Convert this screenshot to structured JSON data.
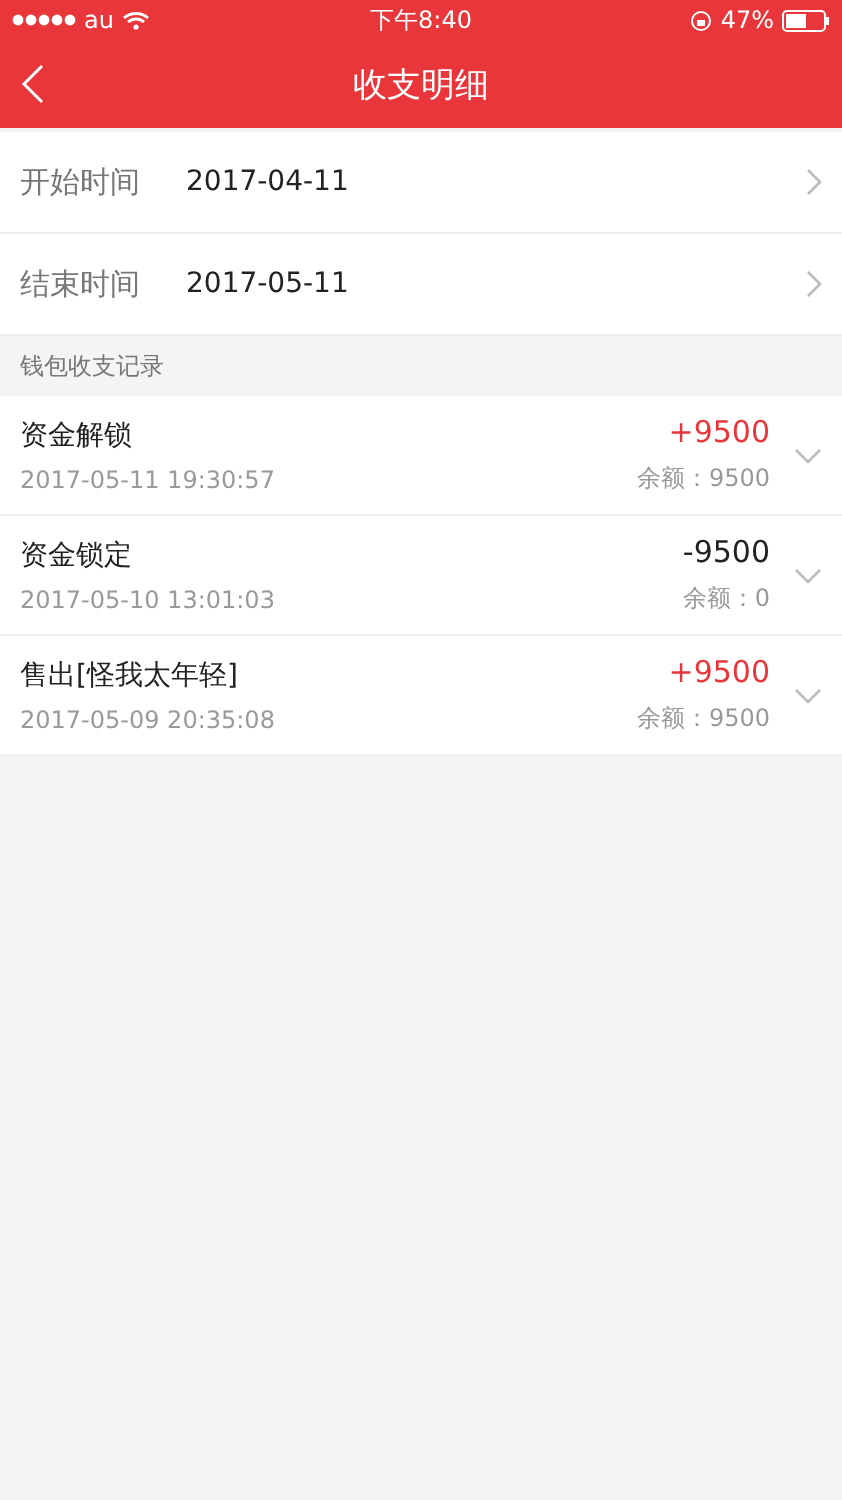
{
  "status_bar": {
    "carrier": "au",
    "time": "下午8:40",
    "battery": "47%"
  },
  "nav": {
    "title": "收支明细"
  },
  "filters": [
    {
      "label": "开始时间",
      "value": "2017-04-11"
    },
    {
      "label": "结束时间",
      "value": "2017-05-11"
    }
  ],
  "section": {
    "title": "钱包收支记录"
  },
  "records": [
    {
      "title": "资金解锁",
      "time": "2017-05-11 19:30:57",
      "amount": "+9500",
      "kind": "income",
      "balance": "余额：9500"
    },
    {
      "title": "资金锁定",
      "time": "2017-05-10 13:01:03",
      "amount": "-9500",
      "kind": "expense",
      "balance": "余额：0"
    },
    {
      "title": "售出[怪我太年轻]",
      "time": "2017-05-09 20:35:08",
      "amount": "+9500",
      "kind": "income",
      "balance": "余额：9500"
    }
  ]
}
